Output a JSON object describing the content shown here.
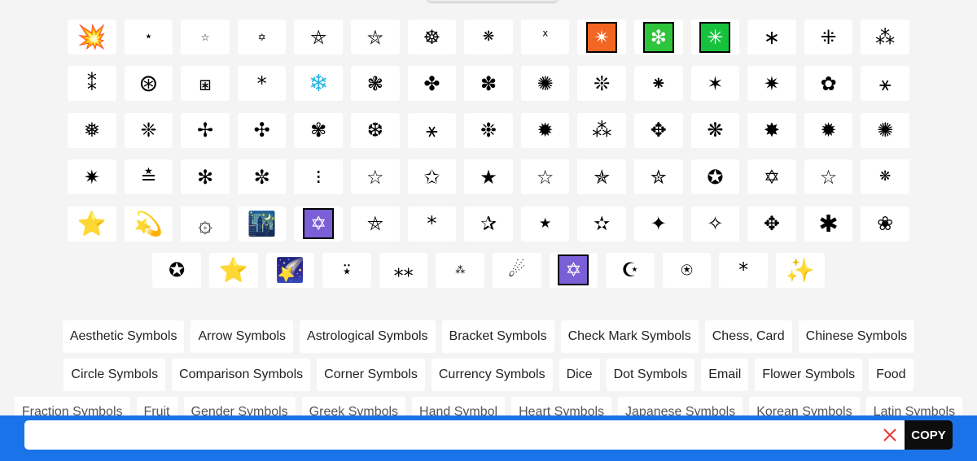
{
  "symbol_rows": [
    [
      {
        "glyph": "💥",
        "icon": "collision-icon",
        "size": "lg"
      },
      {
        "glyph": "⋆",
        "icon": "small-star-icon",
        "size": "sm"
      },
      {
        "glyph": "☆",
        "icon": "outline-star-icon",
        "size": "xs"
      },
      {
        "glyph": "✡",
        "icon": "star-of-david-icon",
        "size": "xs"
      },
      {
        "glyph": "⛤",
        "icon": "pentagram-icon",
        "size": "md"
      },
      {
        "glyph": "⛦",
        "icon": "pentagram-circle-icon",
        "size": "md"
      },
      {
        "glyph": "☸",
        "icon": "wheel-icon",
        "size": "md"
      },
      {
        "glyph": "❋",
        "icon": "propeller-asterisk-icon",
        "size": "sm"
      },
      {
        "glyph": "ᕁ",
        "icon": "ring-of-x-icon",
        "size": "sm"
      },
      {
        "glyph": "✴",
        "icon": "orange-sparkle-square-icon",
        "size": "md",
        "boxed_color": "#f26522"
      },
      {
        "glyph": "❇",
        "icon": "green-sparkle-square-icon",
        "size": "md",
        "boxed_color": "#2ec43b"
      },
      {
        "glyph": "✳",
        "icon": "green-asterisk-square-icon",
        "size": "md",
        "boxed_color": "#16c23c"
      },
      {
        "glyph": "∗",
        "icon": "asterisk-operator-icon",
        "size": "md"
      },
      {
        "glyph": "⁜",
        "icon": "dotted-cross-icon",
        "size": "md"
      },
      {
        "glyph": "⁂",
        "icon": "asterism-icon",
        "size": "md"
      }
    ],
    [
      {
        "glyph": "⁑",
        "icon": "two-asterisks-icon",
        "size": "md"
      },
      {
        "glyph": "⊛",
        "icon": "circled-asterisk-icon",
        "size": "lg"
      },
      {
        "glyph": "⧆",
        "icon": "squared-asterisk-icon",
        "size": "md"
      },
      {
        "glyph": "*",
        "icon": "asterisk-icon",
        "size": "md"
      },
      {
        "glyph": "❄",
        "icon": "snowflake-emoji-icon",
        "size": "lg",
        "color": "#2bb5e6"
      },
      {
        "glyph": "❃",
        "icon": "petalled-asterisk-icon",
        "size": "md"
      },
      {
        "glyph": "✤",
        "icon": "four-balloon-asterisk-icon",
        "size": "md"
      },
      {
        "glyph": "✽",
        "icon": "teardrop-asterisk-icon",
        "size": "md"
      },
      {
        "glyph": "✺",
        "icon": "sixteen-pointed-asterisk-icon",
        "size": "md"
      },
      {
        "glyph": "❊",
        "icon": "eight-teardrop-propeller-icon",
        "size": "md"
      },
      {
        "glyph": "⁕",
        "icon": "flower-punctuation-icon",
        "size": "md"
      },
      {
        "glyph": "✶",
        "icon": "six-pointed-black-star-icon",
        "size": "md"
      },
      {
        "glyph": "✷",
        "icon": "eight-pointed-rectilinear-star-icon",
        "size": "md"
      },
      {
        "glyph": "✿",
        "icon": "florette-icon",
        "size": "md"
      },
      {
        "glyph": "⚹",
        "icon": "sextile-icon",
        "size": "md"
      }
    ],
    [
      {
        "glyph": "❅",
        "icon": "tight-trifoliate-snowflake-icon",
        "size": "md"
      },
      {
        "glyph": "❈",
        "icon": "heavy-sparkle-icon",
        "size": "md"
      },
      {
        "glyph": "✢",
        "icon": "four-teardrop-asterisk-icon",
        "size": "md"
      },
      {
        "glyph": "✣",
        "icon": "four-balloon-spoked-asterisk-icon",
        "size": "md"
      },
      {
        "glyph": "✾",
        "icon": "six-petalled-florette-icon",
        "size": "md"
      },
      {
        "glyph": "❆",
        "icon": "heavy-chevron-snowflake-icon",
        "size": "md"
      },
      {
        "glyph": "⚹",
        "icon": "thin-sextile-icon",
        "size": "md"
      },
      {
        "glyph": "❉",
        "icon": "balloon-spoked-asterisk-icon",
        "size": "md"
      },
      {
        "glyph": "✹",
        "icon": "twelve-pointed-star-icon",
        "size": "md"
      },
      {
        "glyph": "⁂",
        "icon": "asterism-triple-icon",
        "size": "md"
      },
      {
        "glyph": "✥",
        "icon": "four-club-spoked-asterisk-icon",
        "size": "md"
      },
      {
        "glyph": "❋",
        "icon": "heavy-propeller-asterisk-icon",
        "size": "md"
      },
      {
        "glyph": "✸",
        "icon": "heavy-eight-pointed-star-icon",
        "size": "md"
      },
      {
        "glyph": "✹",
        "icon": "starburst-icon",
        "size": "md"
      },
      {
        "glyph": "✺",
        "icon": "sixteen-teardrop-asterisk-icon",
        "size": "md"
      }
    ],
    [
      {
        "glyph": "✷",
        "icon": "eight-pointed-black-star-icon",
        "size": "md"
      },
      {
        "glyph": "≛",
        "icon": "star-equals-icon",
        "size": "md"
      },
      {
        "glyph": "✻",
        "icon": "teardrop-spoked-asterisk-icon",
        "size": "md"
      },
      {
        "glyph": "✼",
        "icon": "open-centre-teardrop-asterisk-icon",
        "size": "md"
      },
      {
        "glyph": "⁝",
        "icon": "triple-asterisk-column-icon",
        "size": "md"
      },
      {
        "glyph": "☆",
        "icon": "white-star-icon",
        "size": "md"
      },
      {
        "glyph": "✩",
        "icon": "stress-outlined-star-icon",
        "size": "md"
      },
      {
        "glyph": "★",
        "icon": "black-star-icon",
        "size": "md"
      },
      {
        "glyph": "☆",
        "icon": "thin-white-star-icon",
        "size": "md"
      },
      {
        "glyph": "✯",
        "icon": "pinwheel-star-icon",
        "size": "md"
      },
      {
        "glyph": "✮",
        "icon": "heavy-outlined-black-star-icon",
        "size": "md"
      },
      {
        "glyph": "✪",
        "icon": "circled-white-star-icon",
        "size": "md"
      },
      {
        "glyph": "✡",
        "icon": "outlined-star-of-david-icon",
        "size": "md"
      },
      {
        "glyph": "☆",
        "icon": "light-white-star-icon",
        "size": "md"
      },
      {
        "glyph": "❋",
        "icon": "small-propeller-icon",
        "size": "sm"
      }
    ],
    [
      {
        "glyph": "⭐",
        "icon": "glowing-star-emoji-icon",
        "size": "lg",
        "color": "#f7c52b"
      },
      {
        "glyph": "💫",
        "icon": "dizzy-emoji-icon",
        "size": "lg",
        "color": "#1e90ff"
      },
      {
        "glyph": "۞",
        "icon": "rub-el-hizb-icon",
        "size": "lg"
      },
      {
        "glyph": "🌃",
        "icon": "night-city-emoji-icon",
        "size": "lg",
        "color": "#2a6ad8"
      },
      {
        "glyph": "✡",
        "icon": "star-of-david-square-icon",
        "size": "md",
        "boxed_color": "#7b5fd6"
      },
      {
        "glyph": "⛤",
        "icon": "pentagram-outline-icon",
        "size": "md"
      },
      {
        "glyph": "*",
        "icon": "asterisk-small-icon",
        "size": "md"
      },
      {
        "glyph": "✰",
        "icon": "shadowed-white-star-icon",
        "size": "md"
      },
      {
        "glyph": "★",
        "icon": "small-black-star-icon",
        "size": "sm"
      },
      {
        "glyph": "✫",
        "icon": "open-centre-black-star-icon",
        "size": "md"
      },
      {
        "glyph": "✦",
        "icon": "black-four-pointed-star-icon",
        "size": "md"
      },
      {
        "glyph": "✧",
        "icon": "white-four-pointed-star-icon",
        "size": "md"
      },
      {
        "glyph": "✥",
        "icon": "arrow-cross-icon",
        "size": "md"
      },
      {
        "glyph": "✱",
        "icon": "heavy-asterisk-icon",
        "size": "lg"
      },
      {
        "glyph": "❀",
        "icon": "black-florette-icon",
        "size": "md"
      }
    ],
    [
      {
        "glyph": "✪",
        "icon": "circled-star-white-icon",
        "size": "md"
      },
      {
        "glyph": "⭐",
        "icon": "star-emoji-icon",
        "size": "lg",
        "color": "#f7c52b"
      },
      {
        "glyph": "🌠",
        "icon": "shooting-star-emoji-icon",
        "size": "lg",
        "color": "#4d7be0"
      },
      {
        "glyph": "⍣",
        "icon": "star-diaeresis-icon",
        "size": "md"
      },
      {
        "glyph": "⁎⁎",
        "icon": "double-low-asterisk-icon",
        "size": "md"
      },
      {
        "glyph": "⁂",
        "icon": "small-x-cluster-icon",
        "size": "xs"
      },
      {
        "glyph": "☄",
        "icon": "comet-icon",
        "size": "md"
      },
      {
        "glyph": "✡",
        "icon": "six-pointed-star-square-icon",
        "size": "md",
        "boxed_color": "#7b5fd6"
      },
      {
        "glyph": "☪",
        "icon": "star-and-crescent-icon",
        "size": "md"
      },
      {
        "glyph": "⍟",
        "icon": "circle-star-icon",
        "size": "md"
      },
      {
        "glyph": "*",
        "icon": "asterisk-plain-icon",
        "size": "md"
      },
      {
        "glyph": "✨",
        "icon": "sparkles-emoji-icon",
        "size": "lg",
        "color": "#f7c52b"
      }
    ]
  ],
  "tag_rows": [
    [
      "Aesthetic Symbols",
      "Arrow Symbols",
      "Astrological Symbols",
      "Bracket Symbols",
      "Check Mark Symbols",
      "Chess, Card",
      "Chinese Symbols"
    ],
    [
      "Circle Symbols",
      "Comparison Symbols",
      "Corner Symbols",
      "Currency Symbols",
      "Dice",
      "Dot Symbols",
      "Email",
      "Flower Symbols",
      "Food"
    ],
    [
      "Fraction Symbols",
      "Fruit",
      "Gender Symbols",
      "Greek Symbols",
      "Hand Symbol",
      "Heart Symbols",
      "Japanese Symbols",
      "Korean Symbols",
      "Latin Symbols"
    ]
  ],
  "copy_bar": {
    "input_value": "",
    "copy_label": "COPY",
    "clear_icon": "close-x-icon",
    "bar_color": "#1a73e8",
    "button_color": "#0d0d0d",
    "clear_color": "#e53935"
  }
}
